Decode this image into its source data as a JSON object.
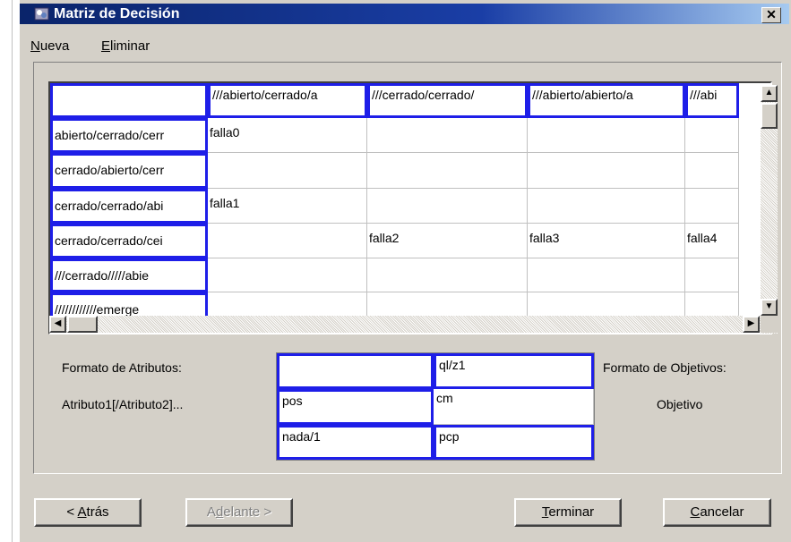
{
  "window": {
    "title": "Matriz de Decisión",
    "close_glyph": "✕"
  },
  "menu": [
    {
      "key": "N",
      "rest": "ueva"
    },
    {
      "key": "E",
      "rest": "liminar"
    }
  ],
  "grid": {
    "column_headers": [
      "",
      "///abierto/cerrado/a",
      "///cerrado/cerrado/",
      "///abierto/abierto/a",
      "///abi"
    ],
    "rows": [
      {
        "header": "abierto/cerrado/cerr",
        "cells": [
          "falla0",
          "",
          "",
          ""
        ]
      },
      {
        "header": "cerrado/abierto/cerr",
        "cells": [
          "",
          "",
          "",
          ""
        ]
      },
      {
        "header": "cerrado/cerrado/abi",
        "cells": [
          "falla1",
          "",
          "",
          ""
        ]
      },
      {
        "header": "cerrado/cerrado/cei",
        "cells": [
          "",
          "falla2",
          "falla3",
          "falla4"
        ]
      },
      {
        "header": "///cerrado/////abie",
        "cells": [
          "",
          "",
          "",
          ""
        ]
      },
      {
        "header": "////////////emerge",
        "cells": [
          "",
          "",
          "",
          ""
        ]
      }
    ],
    "scroll_up_glyph": "▲",
    "scroll_down_glyph": "▼",
    "scroll_left_glyph": "◀",
    "scroll_right_glyph": "▶"
  },
  "attributes": {
    "format_label": "Formato de Atributos:",
    "format_example": "Atributo1[/Atributo2]...",
    "objectives_label": "Formato de Objetivos:",
    "objectives_example": "Objetivo",
    "table": [
      [
        "",
        "ql/z1"
      ],
      [
        "pos",
        "cm"
      ],
      [
        "nada/1",
        "pcp"
      ]
    ]
  },
  "buttons": {
    "back": {
      "prefix": "< ",
      "key": "A",
      "rest": "trás"
    },
    "next": {
      "pre": "A",
      "key": "d",
      "rest": "elante >"
    },
    "finish": {
      "key": "T",
      "rest": "erminar"
    },
    "cancel": {
      "key": "C",
      "rest": "ancelar"
    }
  },
  "colors": {
    "title_bar": "#0a246a",
    "cell_highlight": "#1e1ee8",
    "face": "#d4d0c8"
  },
  "icons": {
    "app": "app-icon"
  }
}
